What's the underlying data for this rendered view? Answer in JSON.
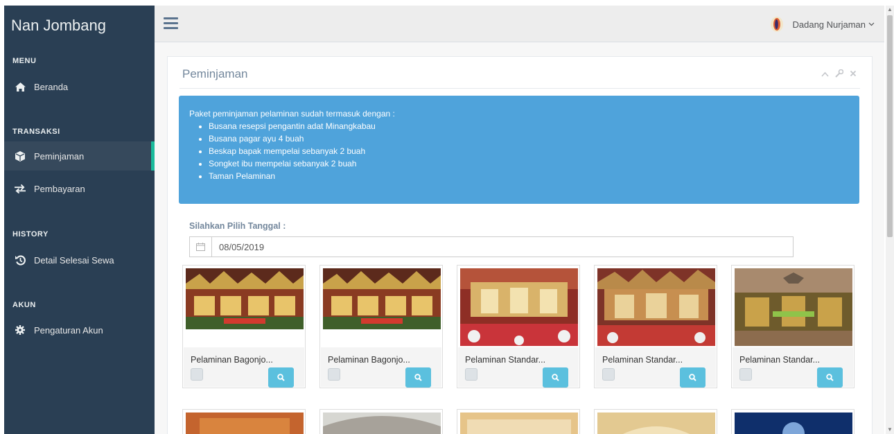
{
  "app": {
    "brand": "Nan Jombang"
  },
  "sidebar": {
    "sections": [
      {
        "label": "MENU",
        "items": [
          {
            "label": "Beranda",
            "icon": "home-icon"
          }
        ]
      },
      {
        "label": "TRANSAKSI",
        "items": [
          {
            "label": "Peminjaman",
            "icon": "cube-icon",
            "active": true
          },
          {
            "label": "Pembayaran",
            "icon": "exchange-icon"
          }
        ]
      },
      {
        "label": "HISTORY",
        "items": [
          {
            "label": "Detail Selesai Sewa",
            "icon": "history-icon"
          }
        ]
      },
      {
        "label": "AKUN",
        "items": [
          {
            "label": "Pengaturan Akun",
            "icon": "gear-icon"
          }
        ]
      }
    ]
  },
  "header": {
    "user_name": "Dadang Nurjaman"
  },
  "panel": {
    "title": "Peminjaman",
    "alert": {
      "intro": "Paket peminjaman pelaminan sudah termasuk dengan :",
      "items": [
        "Busana resepsi pengantin adat Minangkabau",
        "Busana pagar ayu 4 buah",
        "Beskap bapak mempelai sebanyak 2 buah",
        "Songket ibu mempelai sebanyak 2 buah",
        "Taman Pelaminan"
      ]
    },
    "date_label": "Silahkan Pilih Tanggal :",
    "date_value": "08/05/2019",
    "cards": [
      {
        "title": "Pelaminan Bagonjo...",
        "image": "pelaminan-bagonjo-photo"
      },
      {
        "title": "Pelaminan Bagonjo...",
        "image": "pelaminan-bagonjo-photo"
      },
      {
        "title": "Pelaminan Standar...",
        "image": "pelaminan-standar-photo"
      },
      {
        "title": "Pelaminan Standar...",
        "image": "pelaminan-standar-photo"
      },
      {
        "title": "Pelaminan Standar...",
        "image": "pelaminan-standar-photo"
      }
    ]
  },
  "colors": {
    "sidebar_bg": "#2A3F54",
    "sidebar_active": "#36495C",
    "active_accent": "#1ABB9C",
    "alert_bg": "#4FA3DB",
    "button_info": "#5BC0DE"
  }
}
